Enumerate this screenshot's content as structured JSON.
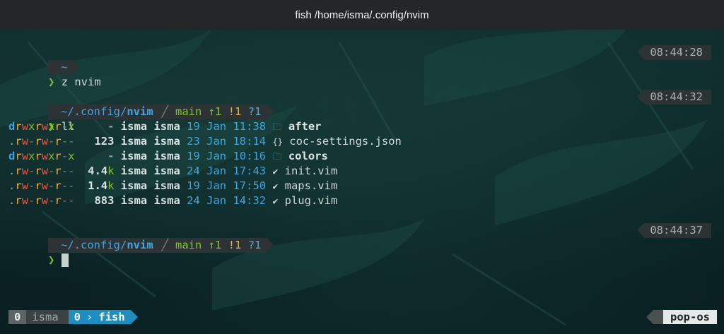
{
  "window": {
    "title": "fish /home/isma/.config/nvim"
  },
  "prompts": [
    {
      "path": "~",
      "time": "08:44:28",
      "command": "z nvim"
    },
    {
      "path_prefix": "~/.config/",
      "path_dir": "nvim",
      "git_branch": "main",
      "git_ahead": "↑1",
      "git_modified": "!1",
      "git_untracked": "?1",
      "time": "08:44:32",
      "command": "ll"
    },
    {
      "path_prefix": "~/.config/",
      "path_dir": "nvim",
      "git_branch": "main",
      "git_ahead": "↑1",
      "git_modified": "!1",
      "git_untracked": "?1",
      "time": "08:44:37",
      "command": ""
    }
  ],
  "prompt_char": "❯",
  "listing": [
    {
      "perm_type": "d",
      "perm_a": "r",
      "perm_b": "w",
      "perm_c": "x",
      "perm_d": "r",
      "perm_e": "w",
      "perm_f": "x",
      "perm_g": "r",
      "perm_h": "-",
      "perm_i": "x",
      "size_num": "-",
      "size_unit": "",
      "user": "isma",
      "group": "isma",
      "date": "19 Jan 11:38",
      "icon": "🗁",
      "name": "after",
      "is_dir": true
    },
    {
      "perm_type": ".",
      "perm_a": "r",
      "perm_b": "w",
      "perm_c": "-",
      "perm_d": "r",
      "perm_e": "w",
      "perm_f": "-",
      "perm_g": "r",
      "perm_h": "-",
      "perm_i": "-",
      "size_num": "123",
      "size_unit": "",
      "user": "isma",
      "group": "isma",
      "date": "23 Jan 18:14",
      "icon": "{}",
      "name": "coc-settings.json",
      "is_dir": false
    },
    {
      "perm_type": "d",
      "perm_a": "r",
      "perm_b": "w",
      "perm_c": "x",
      "perm_d": "r",
      "perm_e": "w",
      "perm_f": "x",
      "perm_g": "r",
      "perm_h": "-",
      "perm_i": "x",
      "size_num": "-",
      "size_unit": "",
      "user": "isma",
      "group": "isma",
      "date": "19 Jan 10:16",
      "icon": "🗁",
      "name": "colors",
      "is_dir": true
    },
    {
      "perm_type": ".",
      "perm_a": "r",
      "perm_b": "w",
      "perm_c": "-",
      "perm_d": "r",
      "perm_e": "w",
      "perm_f": "-",
      "perm_g": "r",
      "perm_h": "-",
      "perm_i": "-",
      "size_num": "4.4",
      "size_unit": "k",
      "user": "isma",
      "group": "isma",
      "date": "24 Jan 17:43",
      "icon": "V",
      "name": "init.vim",
      "is_dir": false
    },
    {
      "perm_type": ".",
      "perm_a": "r",
      "perm_b": "w",
      "perm_c": "-",
      "perm_d": "r",
      "perm_e": "w",
      "perm_f": "-",
      "perm_g": "r",
      "perm_h": "-",
      "perm_i": "-",
      "size_num": "1.4",
      "size_unit": "k",
      "user": "isma",
      "group": "isma",
      "date": "19 Jan 17:50",
      "icon": "V",
      "name": "maps.vim",
      "is_dir": false
    },
    {
      "perm_type": ".",
      "perm_a": "r",
      "perm_b": "w",
      "perm_c": "-",
      "perm_d": "r",
      "perm_e": "w",
      "perm_f": "-",
      "perm_g": "r",
      "perm_h": "-",
      "perm_i": "-",
      "size_num": "883",
      "size_unit": "",
      "user": "isma",
      "group": "isma",
      "date": "24 Jan 14:32",
      "icon": "V",
      "name": "plug.vim",
      "is_dir": false
    }
  ],
  "tmux": {
    "session_index": "0",
    "session_name": "isma",
    "window_index": "0",
    "window_name": "fish",
    "host": "pop-os"
  },
  "colors": {
    "accent": "#3fa5e0",
    "git": "#7ec42b",
    "warn": "#f2b134",
    "bar": "#2d3335",
    "tmux_active": "#1f8ebf"
  }
}
